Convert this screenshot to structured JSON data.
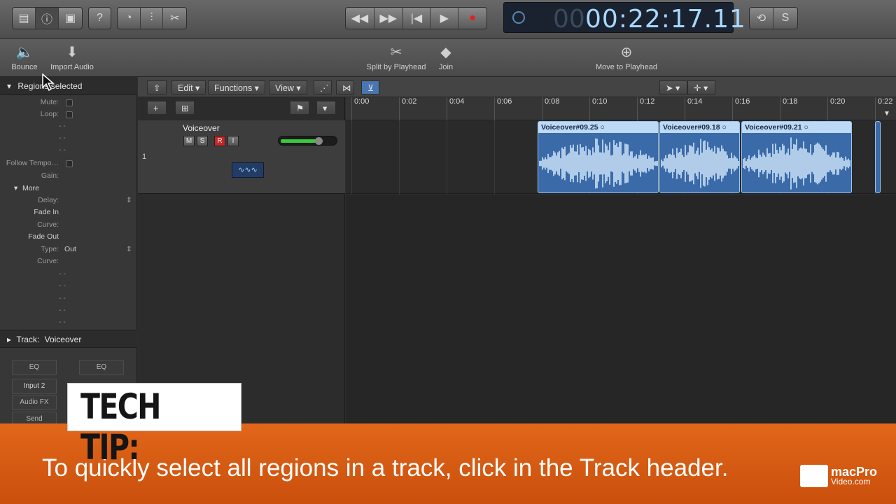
{
  "lcd": {
    "dim": "00",
    "time": "00:22:17.11"
  },
  "toolbar": {
    "bounce": "Bounce",
    "import_audio": "Import Audio",
    "split": "Split by Playhead",
    "join": "Join",
    "move_to_playhead": "Move to Playhead"
  },
  "inspector": {
    "header": "Regions selected",
    "mute": "Mute:",
    "loop": "Loop:",
    "follow_tempo": "Follow Tempo…",
    "gain": "Gain:",
    "more": "More",
    "delay": "Delay:",
    "fade_in": "Fade In",
    "curve1": "Curve:",
    "fade_out": "Fade Out",
    "type": "Type:",
    "type_value": "Out",
    "curve2": "Curve:",
    "dash": "- -",
    "track_label": "Track:",
    "track_name": "Voiceover",
    "eq1": "EQ",
    "eq2": "EQ",
    "input": "Input 2",
    "audio_fx": "Audio FX",
    "send": "Send"
  },
  "menus": {
    "edit": "Edit",
    "functions": "Functions",
    "view": "View"
  },
  "ruler": [
    "0:00",
    "0:02",
    "0:04",
    "0:06",
    "0:08",
    "0:10",
    "0:12",
    "0:14",
    "0:16",
    "0:18",
    "0:20",
    "0:22"
  ],
  "track": {
    "number": "1",
    "name": "Voiceover",
    "m": "M",
    "s": "S",
    "r": "R",
    "i": "I"
  },
  "regions": [
    {
      "name": "Voiceover#09.25"
    },
    {
      "name": "Voiceover#09.18"
    },
    {
      "name": "Voiceover#09.21"
    }
  ],
  "banner": {
    "tip": "TECH TIP:",
    "text": "To quickly select all regions in a track, click in the Track header.",
    "logo_a": "macPro",
    "logo_b": "Video.com"
  },
  "colors": {
    "banner": "#d85c12",
    "region": "#3a6aa8",
    "lcd": "#a7d8ff"
  }
}
